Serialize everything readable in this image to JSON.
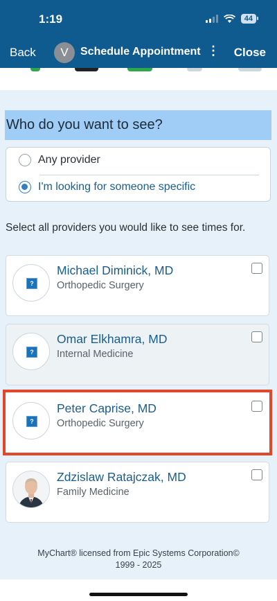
{
  "status": {
    "time": "1:19",
    "battery": "44"
  },
  "nav": {
    "back": "Back",
    "avatar_initial": "V",
    "title": "Schedule Appointment",
    "more": "⋮",
    "close": "Close"
  },
  "question": "Who do you want to see?",
  "options": [
    {
      "label": "Any provider",
      "selected": false
    },
    {
      "label": "I'm looking for someone specific",
      "selected": true
    }
  ],
  "instructions": "Select all providers you would like to see times for.",
  "providers": [
    {
      "name": "Michael Diminick, MD",
      "specialty": "Orthopedic Surgery",
      "checked": false,
      "photo": "placeholder-icon"
    },
    {
      "name": "Omar Elkhamra, MD",
      "specialty": "Internal Medicine",
      "checked": false,
      "photo": "placeholder-icon"
    },
    {
      "name": "Peter Caprise, MD",
      "specialty": "Orthopedic Surgery",
      "checked": false,
      "photo": "placeholder-icon"
    },
    {
      "name": "Zdzislaw Ratajczak, MD",
      "specialty": "Family Medicine",
      "checked": false,
      "photo": "headshot"
    }
  ],
  "footer": {
    "line1": "MyChart® licensed from Epic Systems Corporation©",
    "line2": "1999 - 2025"
  },
  "colors": {
    "header": "#0f5a8f",
    "heading_highlight": "#9fcdf6",
    "selection_outline": "#e2472a",
    "link": "#1a5d8f"
  }
}
